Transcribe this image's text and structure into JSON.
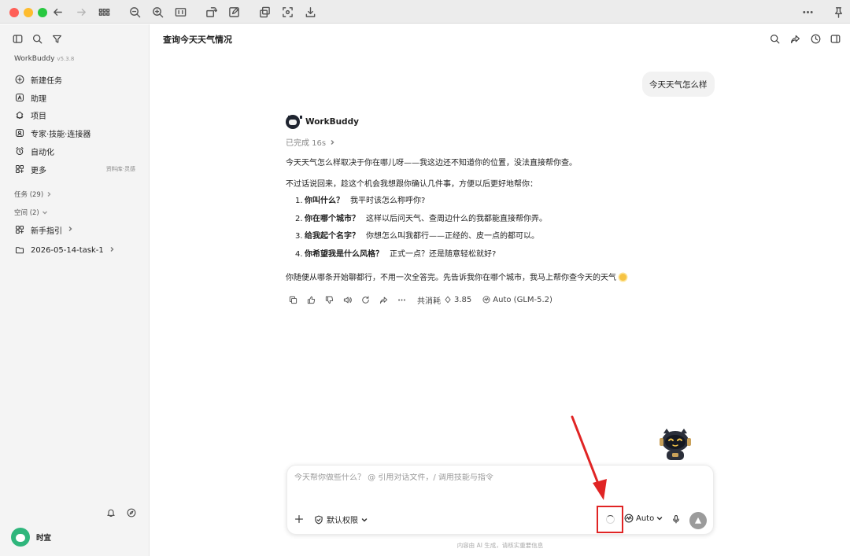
{
  "sidebar": {
    "app_name": "WorkBuddy",
    "version": "v5.3.8",
    "items": [
      {
        "label": "新建任务",
        "icon": "plus-circle-icon"
      },
      {
        "label": "助理",
        "icon": "assistant-icon"
      },
      {
        "label": "项目",
        "icon": "project-icon"
      },
      {
        "label": "专家·技能·连接器",
        "icon": "expert-icon"
      },
      {
        "label": "自动化",
        "icon": "alarm-icon"
      },
      {
        "label": "更多",
        "icon": "grid-icon",
        "extra": "资料库·灵感"
      }
    ],
    "tasks_label": "任务 (29)",
    "spaces_label": "空间 (2)",
    "guide_label": "新手指引",
    "folder_label": "2026-05-14-task-1",
    "user_name": "时宜"
  },
  "header": {
    "title": "查询今天天气情况"
  },
  "conversation": {
    "user_message": "今天天气怎么样",
    "bot_name": "WorkBuddy",
    "status": "已完成 16s",
    "para1": "今天天气怎么样取决于你在哪儿呀——我这边还不知道你的位置，没法直接帮你查。",
    "para2": "不过话说回来，趁这个机会我想跟你确认几件事，方便以后更好地帮你：",
    "list": [
      {
        "num": "1.",
        "bold": "你叫什么？",
        "text": "我平时该怎么称呼你?"
      },
      {
        "num": "2.",
        "bold": "你在哪个城市？",
        "text": "这样以后问天气、查周边什么的我都能直接帮你弄。"
      },
      {
        "num": "3.",
        "bold": "给我起个名字？",
        "text": "你想怎么叫我都行——正经的、皮一点的都可以。"
      },
      {
        "num": "4.",
        "bold": "你希望我是什么风格？",
        "text": "正式一点？还是随意轻松就好?"
      }
    ],
    "para3": "你随便从哪条开始聊都行，不用一次全答完。先告诉我你在哪个城市，我马上帮你查今天的天气",
    "cost_label": "共消耗",
    "cost_value": "3.85",
    "model_label": "Auto (GLM-5.2)"
  },
  "composer": {
    "placeholder": "今天帮你做些什么？ @ 引用对话文件，/ 调用技能与指令",
    "permission_label": "默认权限",
    "mode_label": "Auto"
  },
  "footer_note": "内容由 AI 生成，请核实重要信息",
  "colors": {
    "annotation_red": "#e02424",
    "sidebar_bg": "#f4f4f4",
    "avatar_green": "#2fb67c"
  }
}
